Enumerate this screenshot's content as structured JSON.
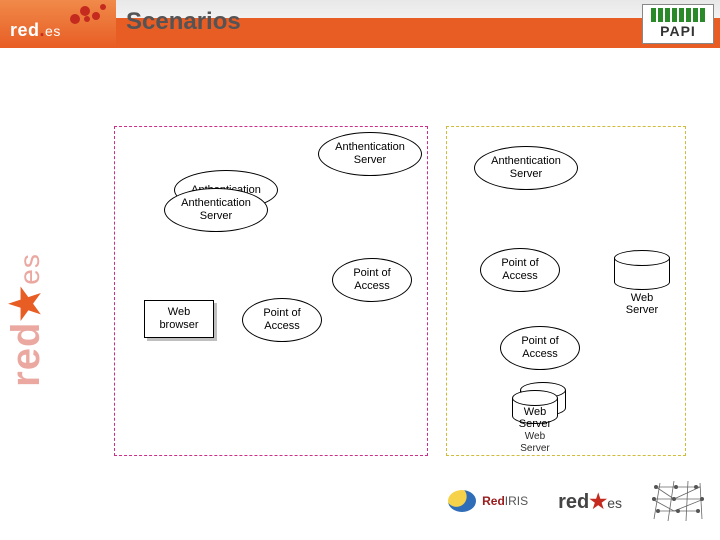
{
  "header": {
    "title": "Scenarios",
    "redes_logo_text_main": "red",
    "redes_logo_text_suffix": "es",
    "papi_label": "PAPI"
  },
  "sidebar": {
    "text_main": "red",
    "text_suffix": "es"
  },
  "nodes": {
    "auth_upper_left_front": "Anthentication\nServer",
    "auth_upper_left_back": "Anthentication",
    "auth_center": "Anthentication\nServer",
    "auth_right": "Anthentication\nServer",
    "poa_center": "Point of\nAccess",
    "poa_left": "Point of\nAccess",
    "poa_right_upper": "Point of\nAccess",
    "poa_right_lower": "Point of\nAccess",
    "web_browser": "Web\nbrowser",
    "cyl_right": "Web\nServer",
    "cyl_stack_back": "Web\nServer",
    "cyl_stack_front": "Web\nServer"
  },
  "footer": {
    "iris_text_prefix": "Red",
    "iris_text_suffix": "IRIS",
    "redes_text_main": "red",
    "redes_text_suffix": "es"
  }
}
